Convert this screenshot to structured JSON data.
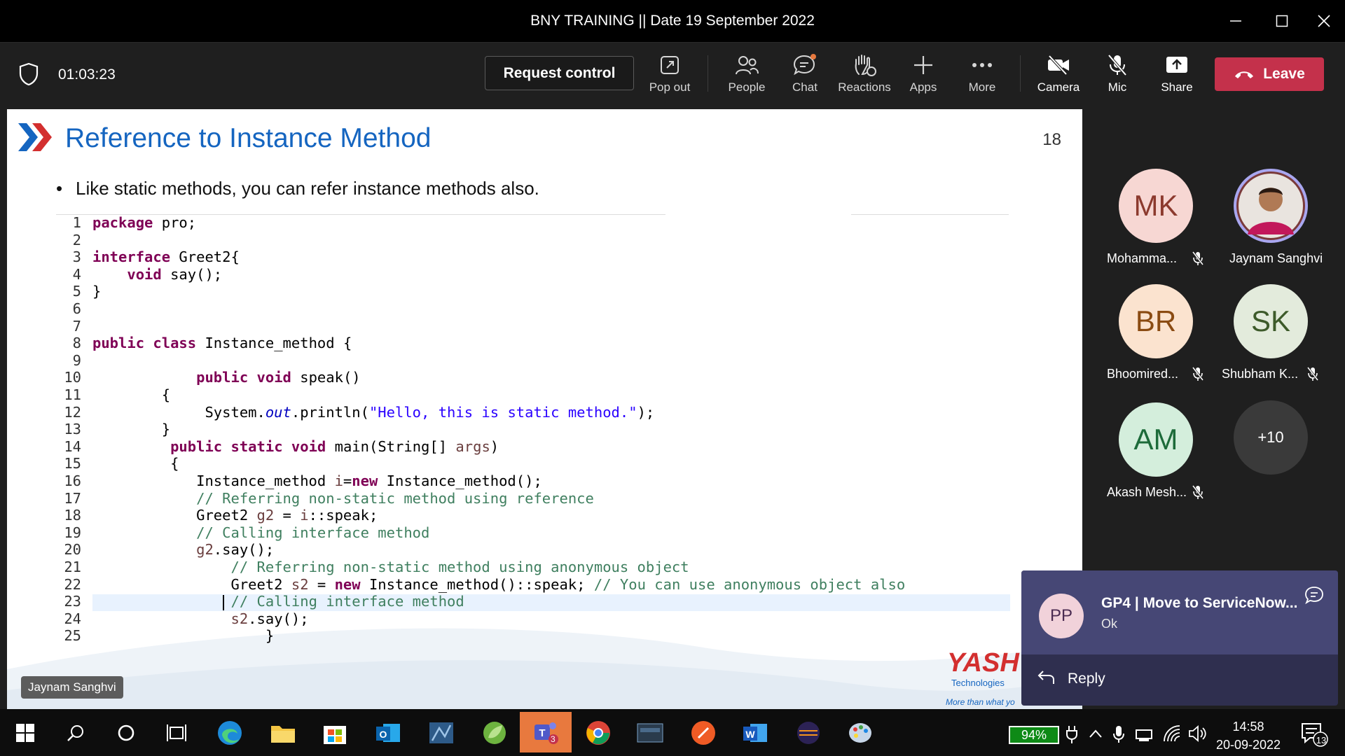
{
  "window": {
    "title": "BNY TRAINING || Date 19 September 2022"
  },
  "toolbar": {
    "timer": "01:03:23",
    "request_control": "Request control",
    "pop_out": "Pop out",
    "people": "People",
    "chat": "Chat",
    "reactions": "Reactions",
    "apps": "Apps",
    "more": "More",
    "camera": "Camera",
    "mic": "Mic",
    "share": "Share",
    "leave": "Leave"
  },
  "slide": {
    "title": "Reference to Instance Method",
    "number": "18",
    "bullet": "Like static methods, you can refer instance methods also.",
    "presenter_chip": "Jaynam Sanghvi",
    "logo": {
      "name": "YASH",
      "sub": "Technologies",
      "tagline": "More than what yo"
    }
  },
  "code_lines": [
    {
      "n": "1",
      "html": "<span class='kw'>package</span> pro;"
    },
    {
      "n": "2",
      "html": ""
    },
    {
      "n": "3",
      "html": "<span class='kw'>interface</span> Greet2{"
    },
    {
      "n": "4",
      "html": "    <span class='kw'>void</span> say();"
    },
    {
      "n": "5",
      "html": "}"
    },
    {
      "n": "6",
      "html": ""
    },
    {
      "n": "7",
      "html": ""
    },
    {
      "n": "8",
      "html": "<span class='kw'>public</span> <span class='kw'>class</span> Instance_method {"
    },
    {
      "n": "9",
      "html": ""
    },
    {
      "n": "10",
      "html": "            <span class='kw'>public</span> <span class='kw'>void</span> speak()"
    },
    {
      "n": "11",
      "html": "        {"
    },
    {
      "n": "12",
      "html": "             System.<span class='fld'>out</span>.println(<span class='str'>\"Hello, this is static method.\"</span>);"
    },
    {
      "n": "13",
      "html": "        }"
    },
    {
      "n": "14",
      "html": "         <span class='kw'>public</span> <span class='kw'>static</span> <span class='kw'>void</span> main(String[] <span class='var'>args</span>)"
    },
    {
      "n": "15",
      "html": "         {"
    },
    {
      "n": "16",
      "html": "            Instance_method <span class='var'>i</span>=<span class='kw'>new</span> Instance_method();"
    },
    {
      "n": "17",
      "html": "            <span class='cm'>// Referring non-static method using reference</span>"
    },
    {
      "n": "18",
      "html": "            Greet2 <span class='var'>g2</span> = <span class='var'>i</span>::speak;"
    },
    {
      "n": "19",
      "html": "            <span class='cm'>// Calling interface method</span>"
    },
    {
      "n": "20",
      "html": "            <span class='var'>g2</span>.say();"
    },
    {
      "n": "21",
      "html": "                <span class='cm'>// Referring non-static method using anonymous object</span>"
    },
    {
      "n": "22",
      "html": "                Greet2 <span class='var'>s2</span> = <span class='kw'>new</span> Instance_method()::speak; <span class='cm'>// You can use anonymous object also</span>"
    },
    {
      "n": "23",
      "html": "                <span class='cm'>// Calling interface method</span>"
    },
    {
      "n": "24",
      "html": "                <span class='var'>s2</span>.say();"
    },
    {
      "n": "25",
      "html": "                    }"
    }
  ],
  "participants": [
    {
      "initials": "MK",
      "name": "Mohamma...",
      "bg": "#f7d7d3",
      "fg": "#8c3a2e",
      "muted": true
    },
    {
      "initials": "",
      "name": "Jaynam Sanghvi",
      "bg": "#7a3a3a",
      "fg": "#fff",
      "muted": false
    },
    {
      "initials": "BR",
      "name": "Bhoomired...",
      "bg": "#fbe3cf",
      "fg": "#8a4b12",
      "muted": true
    },
    {
      "initials": "SK",
      "name": "Shubham K...",
      "bg": "#e3ebdc",
      "fg": "#3d5a2a",
      "muted": true
    },
    {
      "initials": "AM",
      "name": "Akash Mesh...",
      "bg": "#d4eedc",
      "fg": "#1d6b3a",
      "muted": true
    }
  ],
  "overflow_count": "+10",
  "toast": {
    "initials": "PP",
    "title": "GP4 | Move to ServiceNow...",
    "message": "Ok",
    "reply": "Reply"
  },
  "taskbar": {
    "battery": "94%",
    "time": "14:58",
    "date": "20-09-2022",
    "notifications": "13",
    "teams_badge": "3"
  },
  "colors": {
    "leave": "#c4314b",
    "slide_title": "#1565c0",
    "toast": "#464775"
  }
}
